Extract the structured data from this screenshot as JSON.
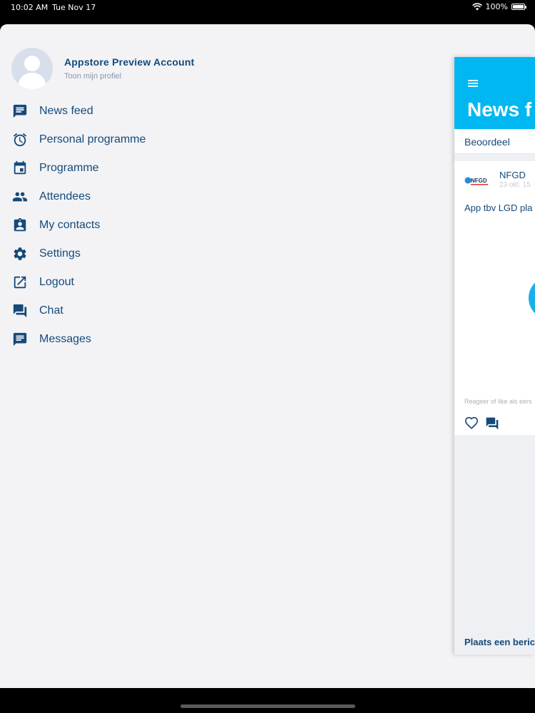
{
  "status_bar": {
    "time": "10:02 AM",
    "date": "Tue Nov 17",
    "battery": "100%"
  },
  "profile": {
    "name": "Appstore Preview Account",
    "link": "Toon mijn profiel"
  },
  "menu": {
    "items": [
      {
        "label": "News feed",
        "icon": "news-feed-icon"
      },
      {
        "label": "Personal programme",
        "icon": "alarm-clock-icon"
      },
      {
        "label": "Programme",
        "icon": "calendar-icon"
      },
      {
        "label": "Attendees",
        "icon": "people-icon"
      },
      {
        "label": "My contacts",
        "icon": "contact-card-icon"
      },
      {
        "label": "Settings",
        "icon": "gear-icon"
      },
      {
        "label": "Logout",
        "icon": "external-link-icon"
      },
      {
        "label": "Chat",
        "icon": "chat-bubbles-icon"
      },
      {
        "label": "Messages",
        "icon": "message-icon"
      }
    ]
  },
  "feed_preview": {
    "title": "News f",
    "rate_label": "Beoordeel",
    "post": {
      "author": "NFGD",
      "date": "23 okt. 15",
      "logo_text": "NFGD",
      "text": "App tbv LGD pla",
      "hint": "Reageer of like als eers"
    },
    "compose_label": "Plaats een beric"
  },
  "colors": {
    "accent": "#00b7f1",
    "navy": "#154a7a",
    "background": "#f3f3f6"
  }
}
